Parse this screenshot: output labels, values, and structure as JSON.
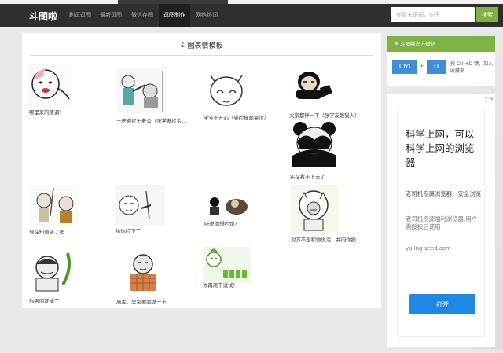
{
  "nav": {
    "logo": "斗图啦",
    "items": [
      "刷逗逗图",
      "最新逗图",
      "微信存图",
      "逗图制作",
      "网络热词"
    ],
    "active_index": 3,
    "search_placeholder": "任意关键词，句子",
    "search_button": "搜索"
  },
  "main": {
    "title": "斗图表情模板",
    "items": [
      {
        "caption": "哪里来的傻逼！"
      },
      {
        "caption": "土老婆打土老公（张学友打金..."
      },
      {
        "caption": "宝宝不开心（猫脸掩面哭泣）"
      },
      {
        "caption": "大家都停一下（张学友戴猫人）"
      },
      {
        "caption": "实在看不下去了"
      },
      {
        "caption": "现在知道错了吧"
      },
      {
        "caption": "给你脸下了"
      },
      {
        "caption": "听说你想约炮？"
      },
      {
        "caption": "对方不想和你说话，并向你扔..."
      },
      {
        "caption": "你男朋友掉了"
      },
      {
        "caption": "施主，您需要超度一下"
      },
      {
        "caption": "你再离下试试！"
      }
    ]
  },
  "sidebar": {
    "box_title": "斗图啦官方微信",
    "key1": "Ctrl",
    "plus": "+",
    "key2": "D",
    "hint": "按 Ctrl+D 键，加入收藏夹"
  },
  "ad": {
    "badge": "广告",
    "headline": "科学上网，可以科学上网的浏览器",
    "sub1": "老司机专属浏览器，安全浏览",
    "sub2": "老司机资源福利浏览器.用户需授权后使用",
    "url": "yuling-seed.com",
    "button": "打开"
  }
}
